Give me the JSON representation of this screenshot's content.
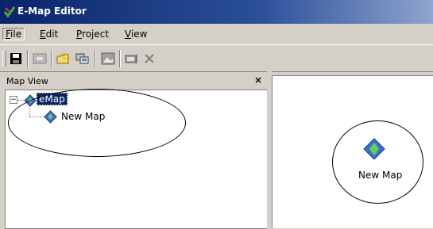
{
  "window": {
    "title": "E-Map Editor",
    "accent": "#0a246a"
  },
  "menu": [
    {
      "label": "File",
      "accel": "F",
      "rest": "ile",
      "selected": true
    },
    {
      "label": "Edit",
      "accel": "E",
      "rest": "dit"
    },
    {
      "label": "Project",
      "accel": "P",
      "rest": "roject"
    },
    {
      "label": "View",
      "accel": "V",
      "rest": "iew"
    }
  ],
  "toolbar": {
    "buttons": [
      "save-icon",
      "map-icon",
      "new-folder-icon",
      "copy-icon",
      "image-icon",
      "rename-icon",
      "delete-icon"
    ]
  },
  "map_view": {
    "title": "Map View",
    "close_glyph": "×",
    "tree": {
      "root": {
        "label": "eMap",
        "expander": "−"
      },
      "children": [
        {
          "label": "New Map"
        }
      ]
    }
  },
  "canvas": {
    "node": {
      "label": "New Map"
    }
  }
}
